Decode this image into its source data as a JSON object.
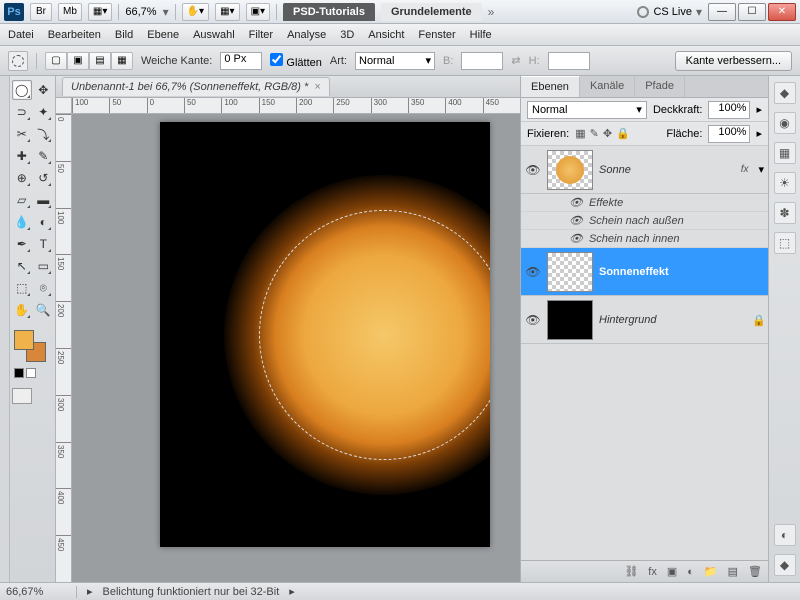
{
  "app": {
    "ps": "Ps"
  },
  "titlebar": {
    "zoom": "66,7%",
    "tab_psd": "PSD-Tutorials",
    "tab_grund": "Grundelemente",
    "cslive": "CS Live",
    "br": "Br",
    "mb": "Mb"
  },
  "menu": [
    "Datei",
    "Bearbeiten",
    "Bild",
    "Ebene",
    "Auswahl",
    "Filter",
    "Analyse",
    "3D",
    "Ansicht",
    "Fenster",
    "Hilfe"
  ],
  "options": {
    "feather_lbl": "Weiche Kante:",
    "feather_val": "0 Px",
    "antialias": "Glätten",
    "style_lbl": "Art:",
    "style_val": "Normal",
    "width_lbl": "B:",
    "height_lbl": "H:",
    "refine": "Kante verbessern..."
  },
  "document": {
    "tab": "Unbenannt-1 bei 66,7% (Sonneneffekt, RGB/8) *",
    "ruler_h": [
      "100",
      "50",
      "0",
      "50",
      "100",
      "150",
      "200",
      "250",
      "300",
      "350",
      "400",
      "450"
    ],
    "ruler_v": [
      "0",
      "50",
      "100",
      "150",
      "200",
      "250",
      "300",
      "350",
      "400",
      "450"
    ]
  },
  "layers_panel": {
    "tabs": [
      "Ebenen",
      "Kanäle",
      "Pfade"
    ],
    "blend_lbl": "Normal",
    "opacity_lbl": "Deckkraft:",
    "opacity_val": "100%",
    "lock_lbl": "Fixieren:",
    "fill_lbl": "Fläche:",
    "fill_val": "100%",
    "layers": [
      {
        "name": "Sonne",
        "fx": "fx"
      },
      {
        "name": "Sonneneffekt"
      },
      {
        "name": "Hintergrund"
      }
    ],
    "effects_lbl": "Effekte",
    "effect1": "Schein nach außen",
    "effect2": "Schein nach innen"
  },
  "status": {
    "zoom": "66,67%",
    "msg": "Belichtung funktioniert nur bei 32-Bit"
  },
  "colors": {
    "fg": "#f0b24a",
    "bg": "#d8863a"
  }
}
